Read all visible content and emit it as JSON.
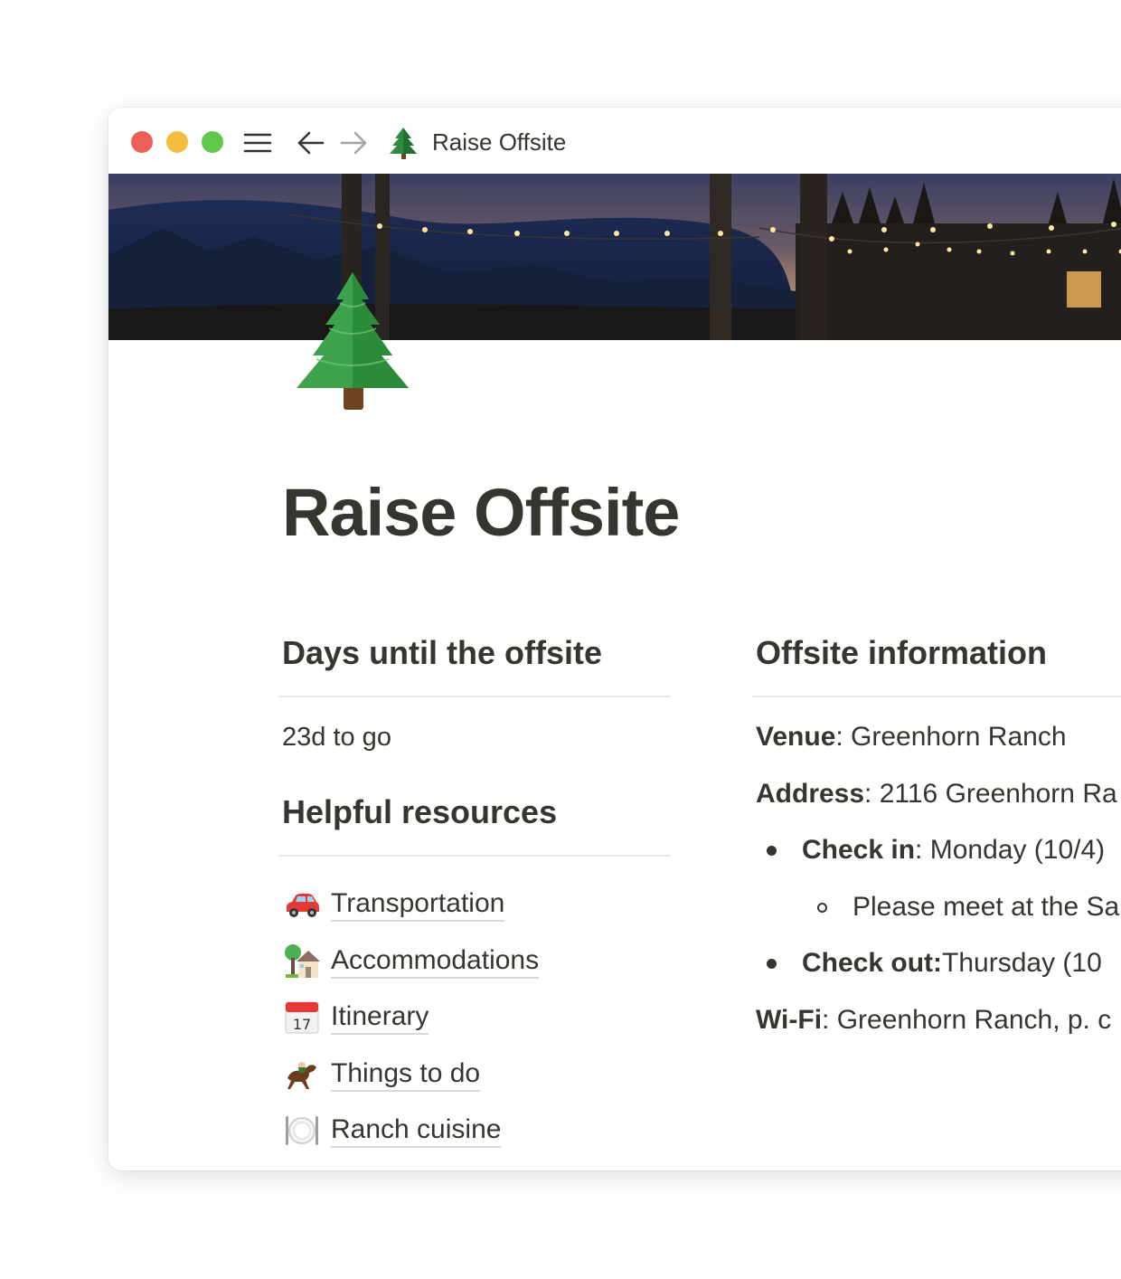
{
  "window": {
    "title": "Raise Offsite",
    "icons": {
      "menu": "hamburger-menu-icon",
      "back": "arrow-left-icon",
      "forward": "arrow-right-icon",
      "page": "evergreen-tree-icon"
    }
  },
  "page": {
    "title": "Raise Offsite",
    "icon": "evergreen-tree-icon"
  },
  "left_column": {
    "days_heading": "Days until the offsite",
    "countdown": "23d to go",
    "resources_heading": "Helpful resources",
    "links": [
      {
        "icon": "car-icon",
        "label": "Transportation"
      },
      {
        "icon": "house-with-garden-icon",
        "label": "Accommodations"
      },
      {
        "icon": "calendar-icon",
        "label": "Itinerary"
      },
      {
        "icon": "horse-racing-icon",
        "label": "Things to do"
      },
      {
        "icon": "plate-with-cutlery-icon",
        "label": "Ranch cuisine"
      }
    ]
  },
  "right_column": {
    "heading": "Offsite information",
    "venue_label": "Venue",
    "venue_value": ": Greenhorn Ranch",
    "address_label": "Address",
    "address_value": ": 2116 Greenhorn Ra",
    "checkin_label": "Check in",
    "checkin_value": ": Monday (10/4)",
    "checkin_note": "Please meet at the Sa",
    "checkout_label": "Check out:",
    "checkout_value": " Thursday (10",
    "wifi_label": "Wi-Fi",
    "wifi_value": ": Greenhorn Ranch, p. c"
  },
  "colors": {
    "text": "#37352f",
    "divider": "#e9e9e7",
    "traffic_red": "#ec5f57",
    "traffic_yellow": "#f4bd40",
    "traffic_green": "#5fc84a"
  }
}
